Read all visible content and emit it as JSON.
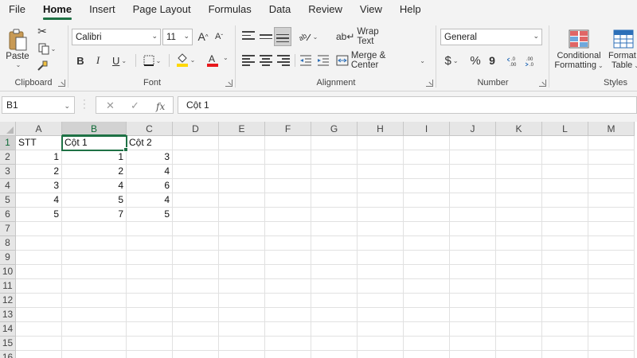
{
  "menu": {
    "tabs": [
      "File",
      "Home",
      "Insert",
      "Page Layout",
      "Formulas",
      "Data",
      "Review",
      "View",
      "Help"
    ],
    "active": "Home"
  },
  "ribbon": {
    "clipboard": {
      "label": "Clipboard",
      "paste": "Paste"
    },
    "font": {
      "label": "Font",
      "name": "Calibri",
      "size": "11",
      "grow": "A",
      "shrink": "A",
      "bold": "B",
      "italic": "I",
      "underline": "U"
    },
    "alignment": {
      "label": "Alignment",
      "wrap": "Wrap Text",
      "merge": "Merge & Center"
    },
    "number": {
      "label": "Number",
      "format": "General",
      "currency": "$",
      "percent": "%",
      "comma": "9"
    },
    "styles": {
      "label": "Styles",
      "conditional": "Conditional",
      "conditional2": "Formatting",
      "table": "Format",
      "table2": "Table"
    },
    "colors": {
      "accent": "#1e7145",
      "fill": "#ffd800",
      "fontcolor": "#e8191d"
    }
  },
  "formula_bar": {
    "name_box": "B1",
    "cancel": "✕",
    "enter": "✓",
    "fx": "fx",
    "content": "Cột 1"
  },
  "grid": {
    "columns": [
      "A",
      "B",
      "C",
      "D",
      "E",
      "F",
      "G",
      "H",
      "I",
      "J",
      "K",
      "L",
      "M"
    ],
    "rows": [
      "1",
      "2",
      "3",
      "4",
      "5",
      "6",
      "7",
      "8",
      "9",
      "10",
      "11",
      "12",
      "13",
      "14",
      "15",
      "16"
    ],
    "selected_cell": "B1",
    "cells": [
      [
        "STT",
        "Cột 1",
        "Cột 2"
      ],
      [
        "1",
        "1",
        "3"
      ],
      [
        "2",
        "2",
        "4"
      ],
      [
        "3",
        "4",
        "6"
      ],
      [
        "4",
        "5",
        "4"
      ],
      [
        "5",
        "7",
        "5"
      ]
    ]
  }
}
